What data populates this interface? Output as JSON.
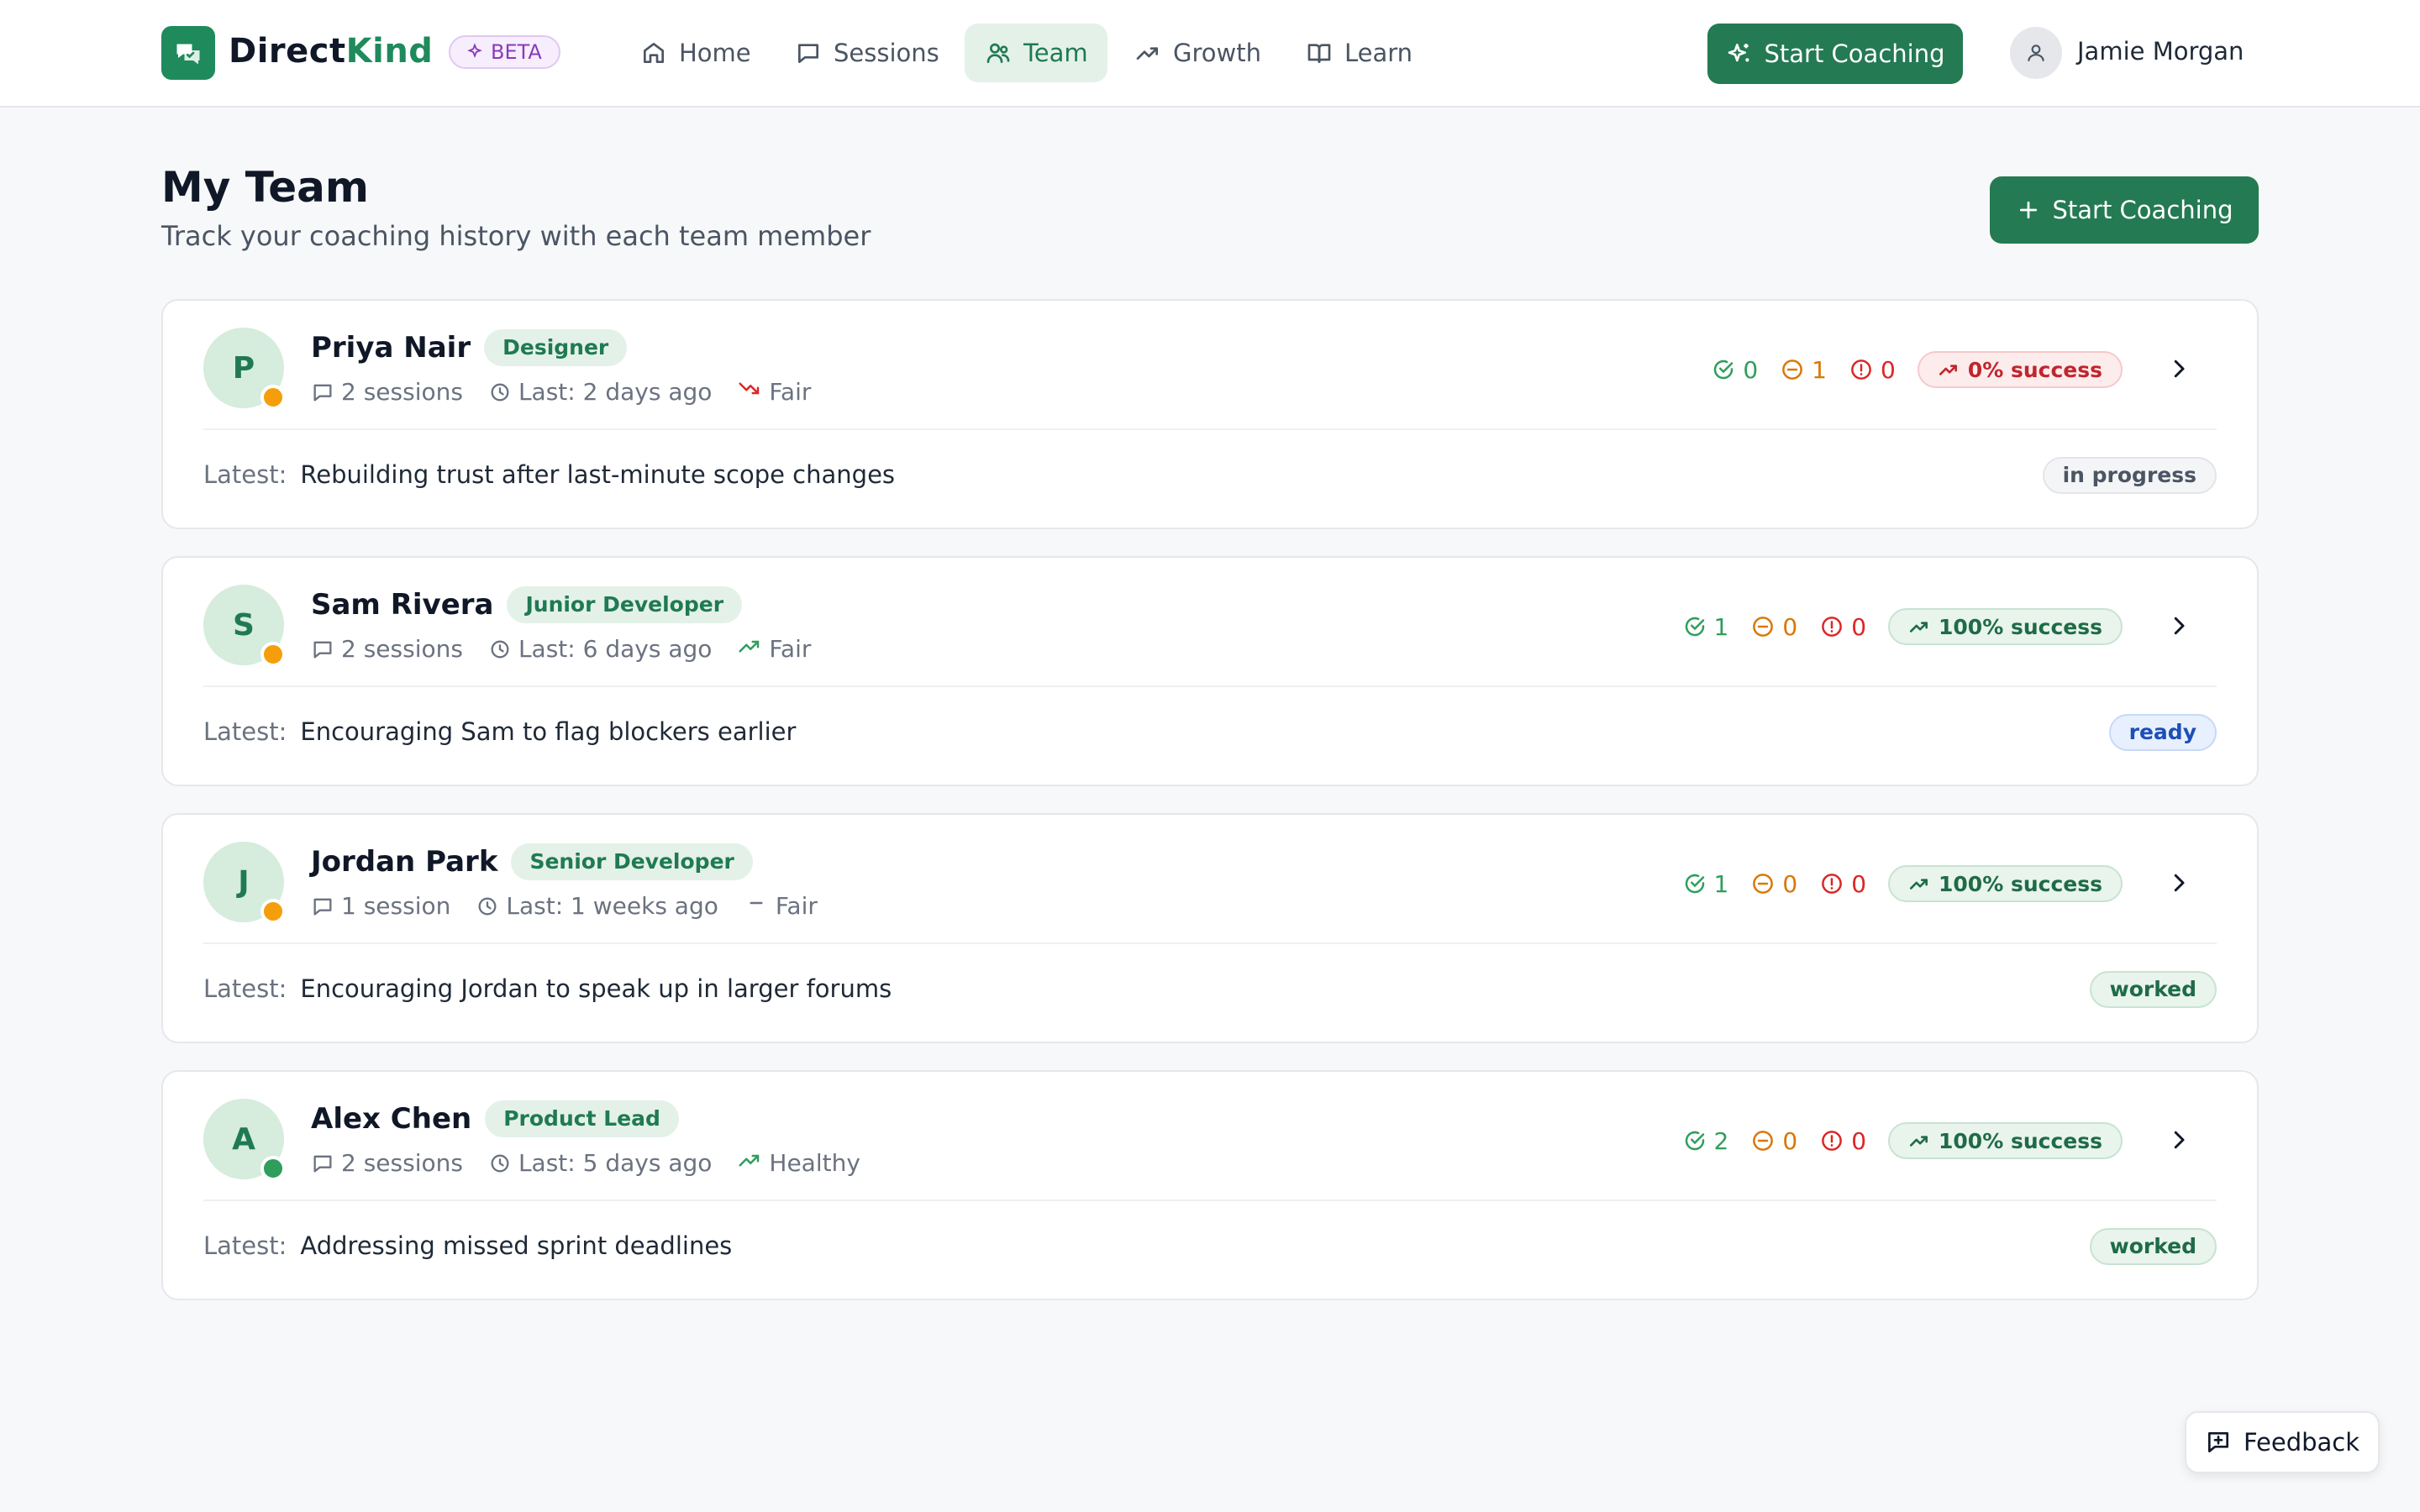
{
  "app": {
    "brand_part1": "Direct",
    "brand_part2": "Kind",
    "beta_label": "BETA"
  },
  "nav": {
    "items": [
      {
        "label": "Home",
        "icon": "home-icon",
        "active": false
      },
      {
        "label": "Sessions",
        "icon": "chat-icon",
        "active": false
      },
      {
        "label": "Team",
        "icon": "users-icon",
        "active": true
      },
      {
        "label": "Growth",
        "icon": "trending-up-icon",
        "active": false
      },
      {
        "label": "Learn",
        "icon": "book-icon",
        "active": false
      }
    ],
    "cta_label": "Start Coaching"
  },
  "user": {
    "name": "Jamie Morgan"
  },
  "page": {
    "title": "My Team",
    "subtitle": "Track your coaching history with each team member",
    "cta_label": "Start Coaching"
  },
  "latest_label": "Latest:",
  "members": [
    {
      "initial": "P",
      "name": "Priya Nair",
      "role": "Designer",
      "sessions": "2 sessions",
      "last": "Last: 2 days ago",
      "trend": "Fair",
      "trend_icon": "trending-down-icon",
      "worked": "0",
      "neutral": "1",
      "issues": "0",
      "success": "0% success",
      "success_state": "bad",
      "latest": "Rebuilding trust after last-minute scope changes",
      "state": "in progress",
      "status_color": "#f59e0b"
    },
    {
      "initial": "S",
      "name": "Sam Rivera",
      "role": "Junior Developer",
      "sessions": "2 sessions",
      "last": "Last: 6 days ago",
      "trend": "Fair",
      "trend_icon": "trending-up-icon",
      "worked": "1",
      "neutral": "0",
      "issues": "0",
      "success": "100% success",
      "success_state": "good",
      "latest": "Encouraging Sam to flag blockers earlier",
      "state": "ready",
      "status_color": "#f59e0b"
    },
    {
      "initial": "J",
      "name": "Jordan Park",
      "role": "Senior Developer",
      "sessions": "1 session",
      "last": "Last: 1 weeks ago",
      "trend": "Fair",
      "trend_icon": "minus-icon",
      "worked": "1",
      "neutral": "0",
      "issues": "0",
      "success": "100% success",
      "success_state": "good",
      "latest": "Encouraging Jordan to speak up in larger forums",
      "state": "worked",
      "status_color": "#f59e0b"
    },
    {
      "initial": "A",
      "name": "Alex Chen",
      "role": "Product Lead",
      "sessions": "2 sessions",
      "last": "Last: 5 days ago",
      "trend": "Healthy",
      "trend_icon": "trending-up-icon",
      "worked": "2",
      "neutral": "0",
      "issues": "0",
      "success": "100% success",
      "success_state": "good",
      "latest": "Addressing missed sprint deadlines",
      "state": "worked",
      "status_color": "#2f9e5c"
    }
  ],
  "feedback_label": "Feedback",
  "colors": {
    "brand": "#1f8a5b",
    "warning": "#f59e0b",
    "danger": "#dc2626",
    "success": "#2f9e5c"
  }
}
